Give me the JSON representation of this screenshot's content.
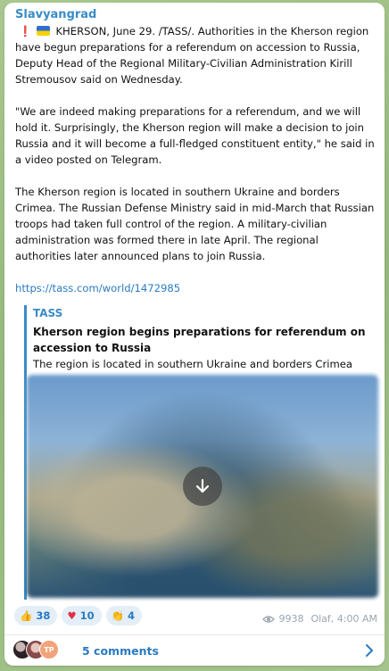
{
  "post": {
    "channel": "Slavyangrad",
    "lead_text": "KHERSON, June 29. /TASS/. Authorities in the Kherson region have begun preparations for a referendum on accession to Russia, Deputy Head of the Regional Military-Civilian Administration Kirill Stremousov said on Wednesday.",
    "paragraph_2": "\"We are indeed making preparations for a referendum, and we will hold it. Surprisingly, the Kherson region will make a decision to join Russia and it will become a full-fledged constituent entity,\" he said in a video posted on Telegram.",
    "paragraph_3": "The Kherson region is located in southern Ukraine and borders Crimea. The Russian Defense Ministry said in mid-March that Russian troops had taken full control of the region. A military-civilian administration was formed there in late April. The regional authorities later announced plans to join Russia.",
    "link": "https://tass.com/world/1472985"
  },
  "preview": {
    "site": "TASS",
    "title": "Kherson region begins preparations for referendum on accession to Russia",
    "description": "The region is located in southern Ukraine and borders Crimea"
  },
  "reactions": [
    {
      "icon": "thumbs-up-icon",
      "count": "38"
    },
    {
      "icon": "heart-icon",
      "count": "10"
    },
    {
      "icon": "clap-icon",
      "count": "4"
    }
  ],
  "meta": {
    "views": "9938",
    "author_time": "Olaf, 4:00 AM"
  },
  "comments": {
    "label": "5 comments",
    "avatar_initials": "TP"
  },
  "colors": {
    "accent": "#3a8cc7",
    "link": "#2a7bc0",
    "heart": "#e0304a"
  }
}
